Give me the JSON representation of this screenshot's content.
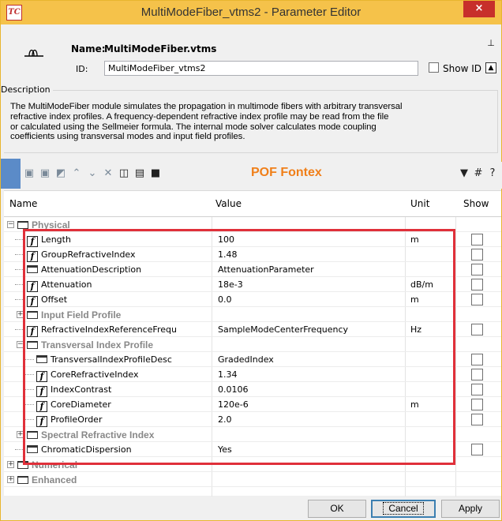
{
  "window": {
    "title": "MultiModeFiber_vtms2 - Parameter Editor",
    "app_icon_text": "TC",
    "close_label": "×"
  },
  "header": {
    "name_label": "Name:",
    "name_value": "MultiModeFiber.vtms",
    "id_label": "ID:",
    "id_value": "MultiModeFiber_vtms2",
    "show_id_label": "Show ID",
    "pin_glyph": "⊥",
    "expand_glyph": "▲"
  },
  "description": {
    "legend": "Description",
    "line1": "The MultiModeFiber module simulates the propagation in multimode fibers with arbitrary transversal",
    "line2": "refractive index profiles. A frequency-dependent refractive index profile may be read from the file",
    "line3": "or calculated using the Sellmeier formula. The internal mode solver calculates mode coupling",
    "line4": "coefficients using transversal modes and input field profiles."
  },
  "toolbar": {
    "title": "POF Fontex",
    "buttons": [
      "add-icon",
      "add-child-icon",
      "copy-icon",
      "up-icon",
      "down-icon",
      "delete-icon",
      "import-icon",
      "export-icon",
      "save-icon"
    ],
    "right_buttons": [
      "filter-icon",
      "grid-icon",
      "help-icon"
    ]
  },
  "grid": {
    "columns": {
      "name": "Name",
      "value": "Value",
      "unit": "Unit",
      "show": "Show"
    },
    "rows": [
      {
        "kind": "group",
        "name": "Physical",
        "value": "",
        "unit": "",
        "expander": "−"
      },
      {
        "kind": "fn",
        "name": "Length",
        "value": "100",
        "unit": "m"
      },
      {
        "kind": "fn",
        "name": "GroupRefractiveIndex",
        "value": "1.48",
        "unit": ""
      },
      {
        "kind": "doc",
        "name": "AttenuationDescription",
        "value": "AttenuationParameter",
        "unit": ""
      },
      {
        "kind": "fn",
        "name": "Attenuation",
        "value": "18e-3",
        "unit": "dB/m"
      },
      {
        "kind": "fn",
        "name": "Offset",
        "value": "0.0",
        "unit": "m"
      },
      {
        "kind": "group",
        "name": "Input Field Profile",
        "value": "",
        "unit": "",
        "expander": "+"
      },
      {
        "kind": "fn",
        "name": "RefractiveIndexReferenceFrequ",
        "value": "SampleModeCenterFrequency",
        "unit": "Hz"
      },
      {
        "kind": "group",
        "name": "Transversal Index Profile",
        "value": "",
        "unit": "",
        "expander": "−"
      },
      {
        "kind": "doc",
        "name": "TransversalIndexProfileDesc",
        "value": "GradedIndex",
        "unit": ""
      },
      {
        "kind": "fn",
        "name": "CoreRefractiveIndex",
        "value": "1.34",
        "unit": ""
      },
      {
        "kind": "fn",
        "name": "IndexContrast",
        "value": "0.0106",
        "unit": ""
      },
      {
        "kind": "fn",
        "name": "CoreDiameter",
        "value": "120e-6",
        "unit": "m"
      },
      {
        "kind": "fn",
        "name": "ProfileOrder",
        "value": "2.0",
        "unit": ""
      },
      {
        "kind": "group",
        "name": "Spectral Refractive Index",
        "value": "",
        "unit": "",
        "expander": "+"
      },
      {
        "kind": "doc",
        "name": "ChromaticDispersion",
        "value": "Yes",
        "unit": ""
      },
      {
        "kind": "group",
        "name": "Numerical",
        "value": "",
        "unit": "",
        "expander": "+"
      },
      {
        "kind": "group",
        "name": "Enhanced",
        "value": "",
        "unit": "",
        "expander": "+"
      }
    ]
  },
  "buttons": {
    "ok": "OK",
    "cancel": "Cancel",
    "apply": "Apply"
  },
  "colors": {
    "titlebar": "#f5c24a",
    "close": "#c7302b",
    "accent_title": "#f07f19",
    "highlight_box": "#e0303a"
  }
}
